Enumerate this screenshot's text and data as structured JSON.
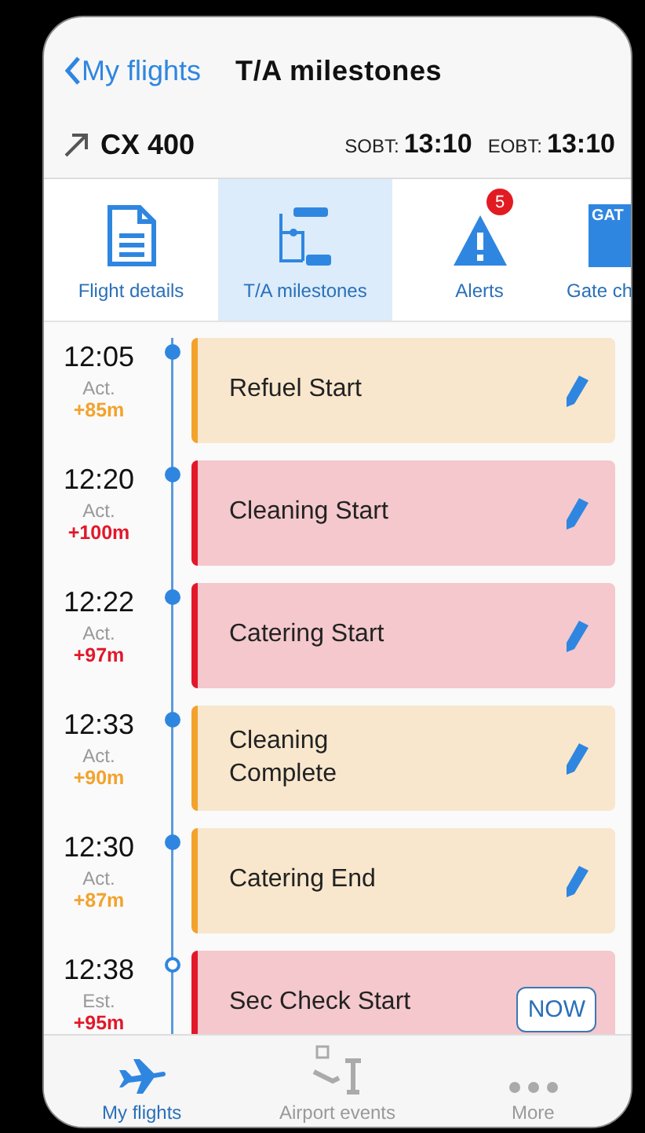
{
  "header": {
    "back": "My flights",
    "title": "T/A milestones"
  },
  "flight": {
    "number": "CX 400",
    "times": [
      {
        "label": "SOBT:",
        "value": "13:10"
      },
      {
        "label": "EOBT:",
        "value": "13:10"
      }
    ]
  },
  "tabs": [
    {
      "kind": "details",
      "label": "Flight details",
      "selected": false
    },
    {
      "kind": "milestones",
      "label": "T/A milestones",
      "selected": true
    },
    {
      "kind": "alerts",
      "label": "Alerts",
      "badge": "5",
      "selected": false
    },
    {
      "kind": "gate",
      "label": "Gate ch",
      "icon_text": "GAT",
      "selected": false
    }
  ],
  "milestones": [
    {
      "time": "12:05",
      "mode": "Act.",
      "delay": "+85m",
      "color": "#f3a22c",
      "completed": true,
      "title": "Refuel Start",
      "action": {
        "kind": "edit"
      }
    },
    {
      "time": "12:20",
      "mode": "Act.",
      "delay": "+100m",
      "color": "#e1182a",
      "completed": true,
      "title": "Cleaning Start",
      "action": {
        "kind": "edit"
      }
    },
    {
      "time": "12:22",
      "mode": "Act.",
      "delay": "+97m",
      "color": "#e1182a",
      "completed": true,
      "title": "Catering Start",
      "action": {
        "kind": "edit"
      }
    },
    {
      "time": "12:33",
      "mode": "Act.",
      "delay": "+90m",
      "color": "#f3a22c",
      "completed": true,
      "title": "Cleaning Complete",
      "action": {
        "kind": "edit"
      }
    },
    {
      "time": "12:30",
      "mode": "Act.",
      "delay": "+87m",
      "color": "#f3a22c",
      "completed": true,
      "title": "Catering End",
      "action": {
        "kind": "edit"
      }
    },
    {
      "time": "12:38",
      "mode": "Est.",
      "delay": "+95m",
      "color": "#e1182a",
      "completed": false,
      "title": "Sec Check Start",
      "action": {
        "kind": "button",
        "label": "NOW"
      }
    }
  ],
  "bottom_nav": [
    {
      "kind": "flights",
      "label": "My flights",
      "selected": true
    },
    {
      "kind": "events",
      "label": "Airport events",
      "selected": false
    },
    {
      "kind": "more",
      "label": "More",
      "selected": false
    }
  ]
}
